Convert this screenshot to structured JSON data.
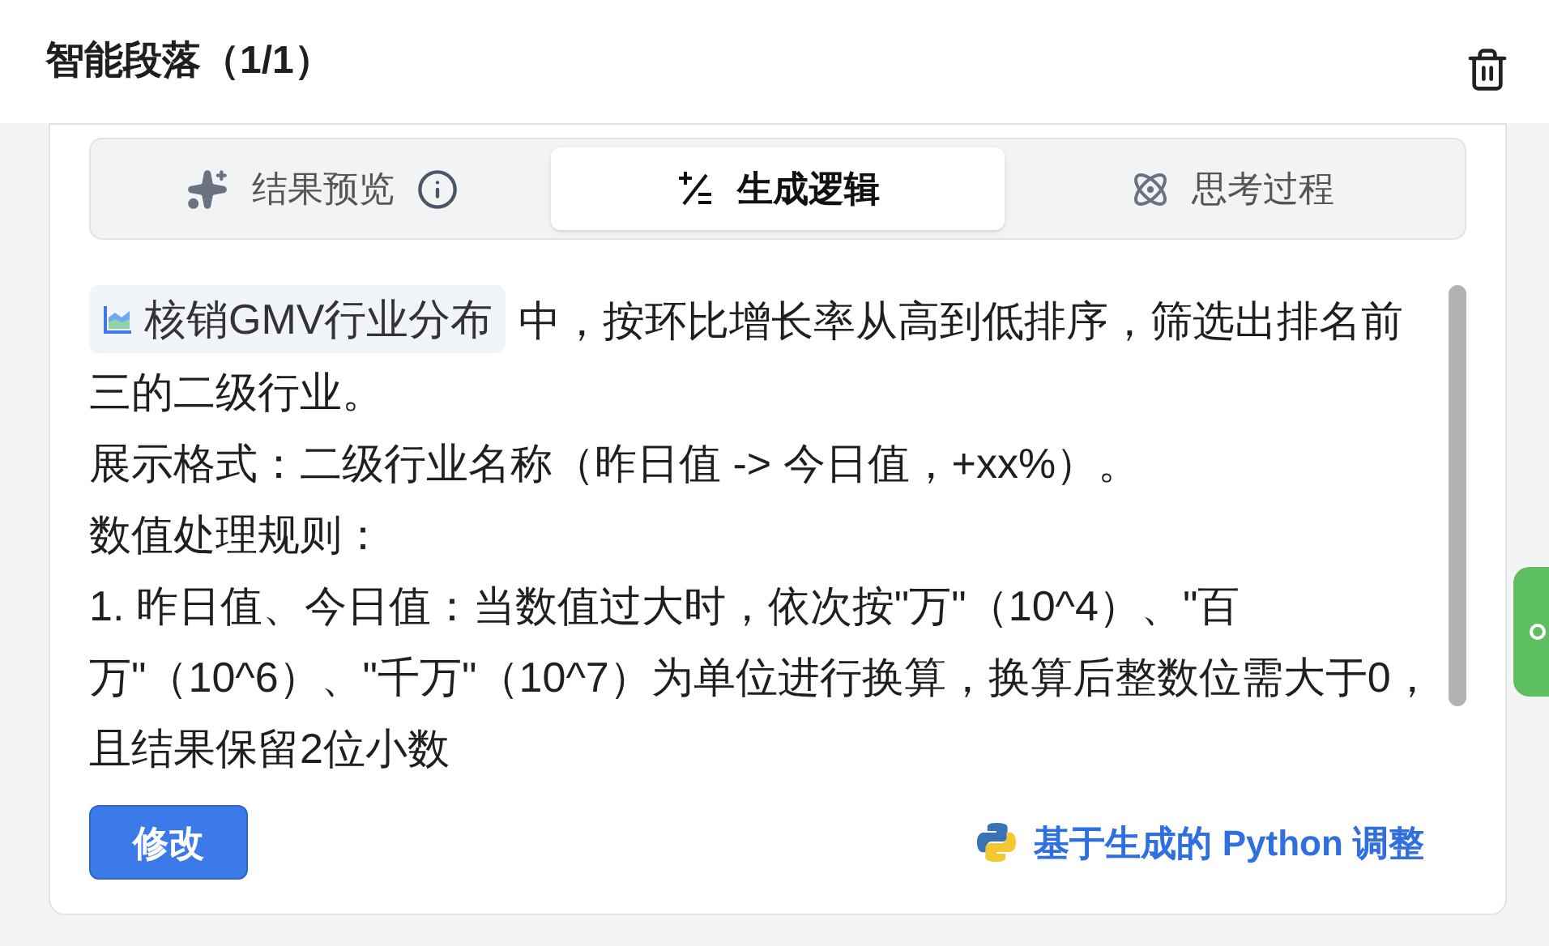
{
  "title": "智能段落（1/1）",
  "tabs": [
    {
      "label": "结果预览",
      "kind": "sparkle",
      "info": true,
      "selected": false
    },
    {
      "label": "生成逻辑",
      "kind": "plusminus",
      "info": false,
      "selected": true
    },
    {
      "label": "思考过程",
      "kind": "atom",
      "info": false,
      "selected": false
    }
  ],
  "content": {
    "chip": "核销GMV行业分布",
    "lead": "中，按环比增长率从高到低排序，筛选出排名前三的二级行业。",
    "paragraphs": [
      "展示格式：二级行业名称（昨日值 -> 今日值，+xx%）。",
      "数值处理规则：",
      "1. 昨日值、今日值：当数值过大时，依次按\"万\"（10^4）、\"百万\"（10^6）、\"千万\"（10^7）为单位进行换算，换算后整数位需大于0，且结果保留2位小数"
    ]
  },
  "edit_button": "修改",
  "python_link": "基于生成的 Python 调整"
}
